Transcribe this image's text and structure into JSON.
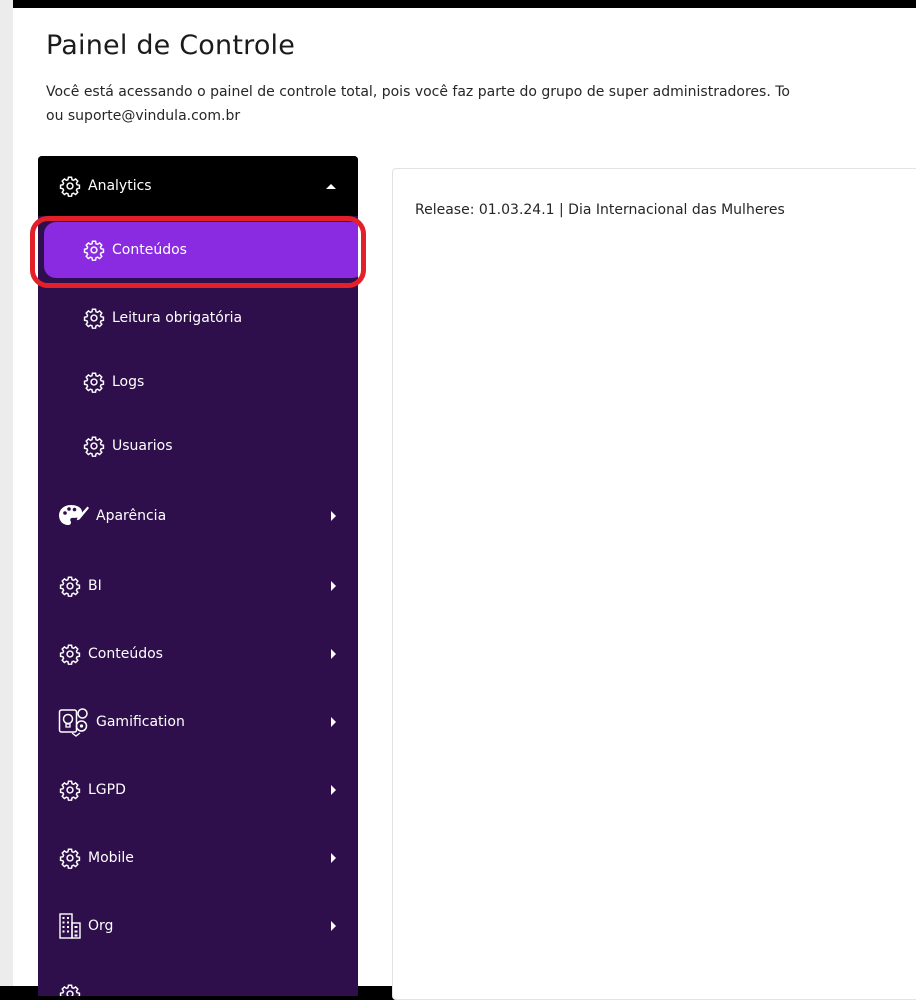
{
  "header": {
    "title": "Painel de Controle",
    "description_line1": "Você está acessando o painel de controle total, pois você faz parte do grupo de super administradores. To",
    "description_line2": "ou suporte@vindula.com.br"
  },
  "sidebar": {
    "section": {
      "label": "Analytics",
      "icon": "gear-icon",
      "expanded": true
    },
    "subitems": [
      {
        "label": "Conteúdos",
        "icon": "gear-icon",
        "active": true
      },
      {
        "label": "Leitura obrigatória",
        "icon": "gear-icon"
      },
      {
        "label": "Logs",
        "icon": "gear-icon"
      },
      {
        "label": "Usuarios",
        "icon": "gear-icon"
      }
    ],
    "items": [
      {
        "label": "Aparência",
        "icon": "palette-icon"
      },
      {
        "label": "BI",
        "icon": "gear-icon"
      },
      {
        "label": "Conteúdos",
        "icon": "gear-icon"
      },
      {
        "label": "Gamification",
        "icon": "gamification-icon"
      },
      {
        "label": "LGPD",
        "icon": "gear-icon"
      },
      {
        "label": "Mobile",
        "icon": "gear-icon"
      },
      {
        "label": "Org",
        "icon": "building-icon"
      }
    ]
  },
  "main": {
    "release_text": "Release: 01.03.24.1 | Dia Internacional das Mulheres"
  },
  "colors": {
    "sidebar_bg": "#2e0f4b",
    "sidebar_header_bg": "#000000",
    "active_item_bg": "#8a2be2",
    "highlight_ring": "#e3202a",
    "text_light": "#ffffff"
  }
}
